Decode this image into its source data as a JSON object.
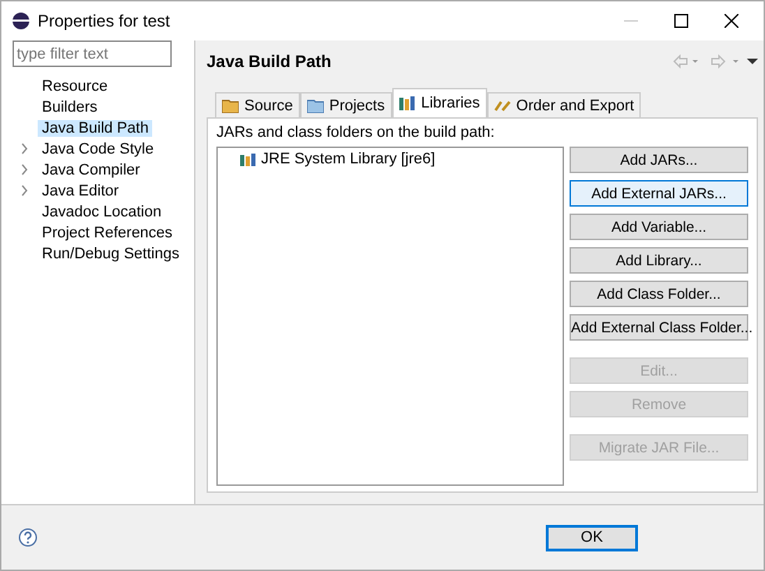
{
  "window": {
    "title": "Properties for test"
  },
  "filter": {
    "placeholder": "type filter text"
  },
  "nav_items": [
    {
      "label": "Resource",
      "expandable": false,
      "selected": false
    },
    {
      "label": "Builders",
      "expandable": false,
      "selected": false
    },
    {
      "label": "Java Build Path",
      "expandable": false,
      "selected": true
    },
    {
      "label": "Java Code Style",
      "expandable": true,
      "selected": false
    },
    {
      "label": "Java Compiler",
      "expandable": true,
      "selected": false
    },
    {
      "label": "Java Editor",
      "expandable": true,
      "selected": false
    },
    {
      "label": "Javadoc Location",
      "expandable": false,
      "selected": false
    },
    {
      "label": "Project References",
      "expandable": false,
      "selected": false
    },
    {
      "label": "Run/Debug Settings",
      "expandable": false,
      "selected": false
    }
  ],
  "page_title": "Java Build Path",
  "tabs": [
    {
      "label": "Source",
      "kind": "source",
      "selected": false
    },
    {
      "label": "Projects",
      "kind": "projects",
      "selected": false
    },
    {
      "label": "Libraries",
      "kind": "libraries",
      "selected": true
    },
    {
      "label": "Order and Export",
      "kind": "order",
      "selected": false
    }
  ],
  "list_label": "JARs and class folders on the build path:",
  "entries": [
    {
      "label": "JRE System Library [jre6]"
    }
  ],
  "button_groups": [
    [
      {
        "label": "Add JARs...",
        "disabled": false,
        "focused": false
      },
      {
        "label": "Add External JARs...",
        "disabled": false,
        "focused": true
      },
      {
        "label": "Add Variable...",
        "disabled": false,
        "focused": false
      },
      {
        "label": "Add Library...",
        "disabled": false,
        "focused": false
      },
      {
        "label": "Add Class Folder...",
        "disabled": false,
        "focused": false
      },
      {
        "label": "Add External Class Folder...",
        "disabled": false,
        "focused": false
      }
    ],
    [
      {
        "label": "Edit...",
        "disabled": true,
        "focused": false
      },
      {
        "label": "Remove",
        "disabled": true,
        "focused": false
      }
    ],
    [
      {
        "label": "Migrate JAR File...",
        "disabled": true,
        "focused": false
      }
    ]
  ],
  "footer": {
    "ok": "OK"
  }
}
